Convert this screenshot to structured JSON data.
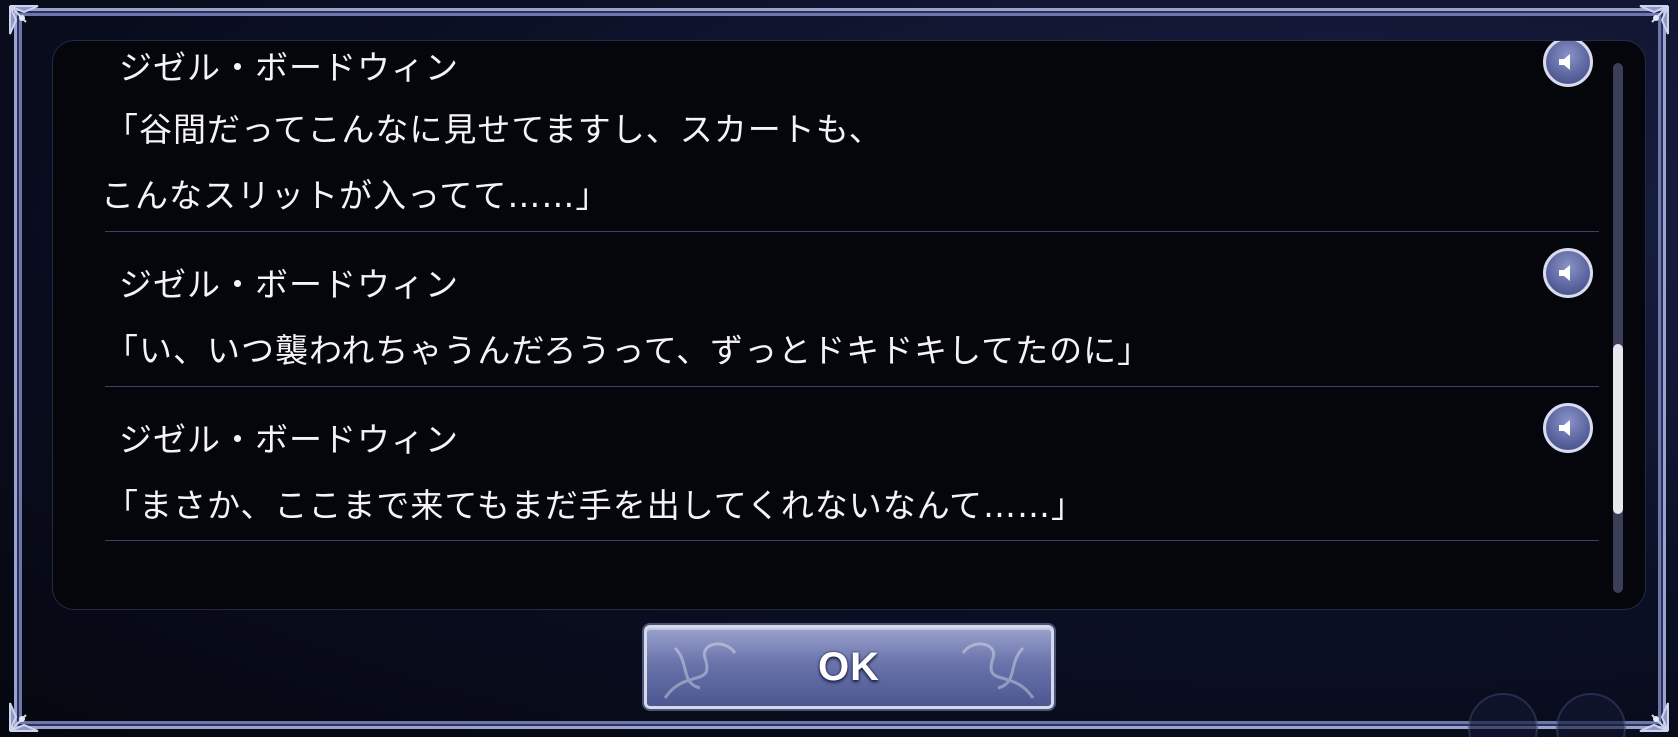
{
  "dialog_log": {
    "entries": [
      {
        "speaker": "ジゼル・ボードウィン",
        "lines": [
          "「谷間だってこんなに見せてますし、スカートも、",
          "こんなスリットが入ってて……」"
        ]
      },
      {
        "speaker": "ジゼル・ボードウィン",
        "lines": [
          "「い、いつ襲われちゃうんだろうって、ずっとドキドキしてたのに」"
        ]
      },
      {
        "speaker": "ジゼル・ボードウィン",
        "lines": [
          "「まさか、ここまで来てもまだ手を出してくれないなんて……」"
        ]
      }
    ],
    "scroll_position": 0.78
  },
  "ok_button": {
    "label": "OK"
  },
  "icons": {
    "voice": "speaker-icon"
  },
  "colors": {
    "accent": "#6a74ab",
    "text": "#f4f4f6",
    "panel": "#04060c"
  }
}
